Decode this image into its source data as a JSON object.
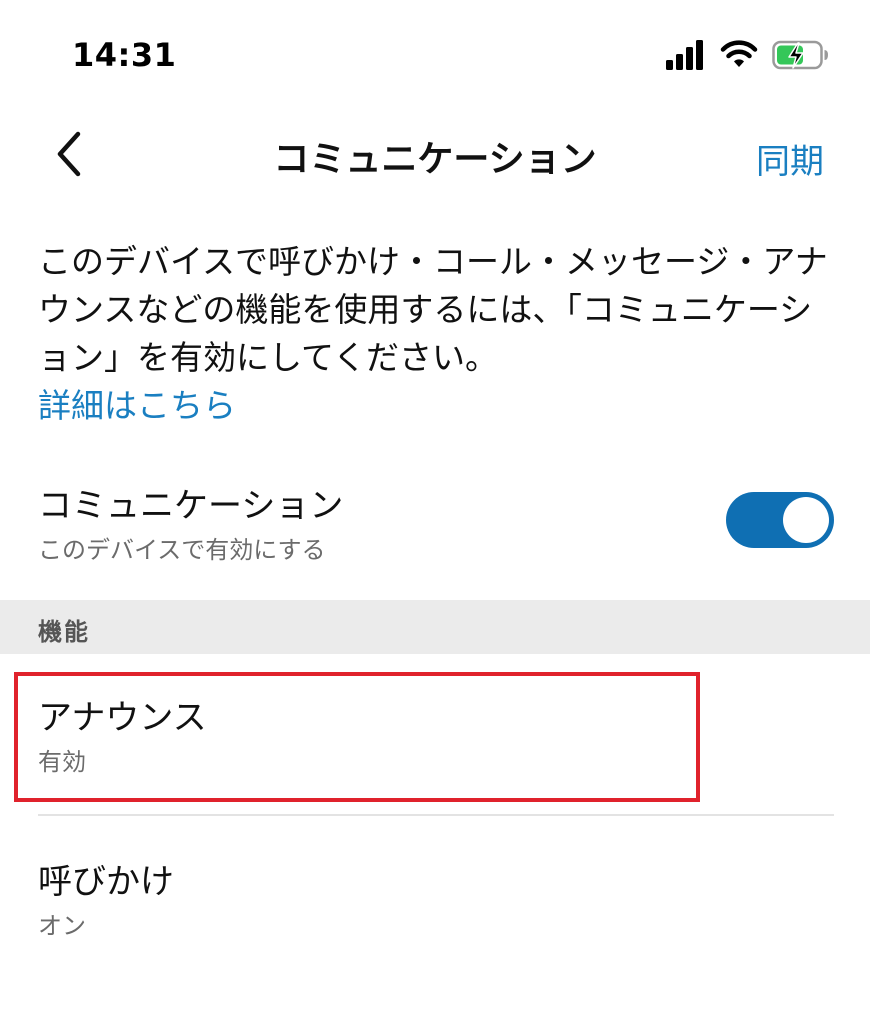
{
  "status_bar": {
    "time": "14:31",
    "icons": [
      "signal-icon",
      "wifi-icon",
      "battery-charging-icon"
    ]
  },
  "nav": {
    "title": "コミュニケーション",
    "sync_label": "同期",
    "back_icon": "chevron-left-icon"
  },
  "description": {
    "text": "このデバイスで呼びかけ・コール・メッセージ・アナウンスなどの機能を使用するには、「コミュニケーション」を有効にしてください。",
    "learn_more": "詳細はこちら"
  },
  "communication": {
    "title": "コミュニケーション",
    "subtitle": "このデバイスで有効にする",
    "enabled": true
  },
  "features_section": {
    "header": "機能",
    "items": [
      {
        "title": "アナウンス",
        "status": "有効"
      },
      {
        "title": "呼びかけ",
        "status": "オン"
      }
    ]
  },
  "colors": {
    "accent": "#1a7fc1",
    "toggle_on": "#0f6fb3",
    "highlight": "#e0222c",
    "section_bg": "#ebebeb",
    "battery_charge": "#34c759"
  }
}
